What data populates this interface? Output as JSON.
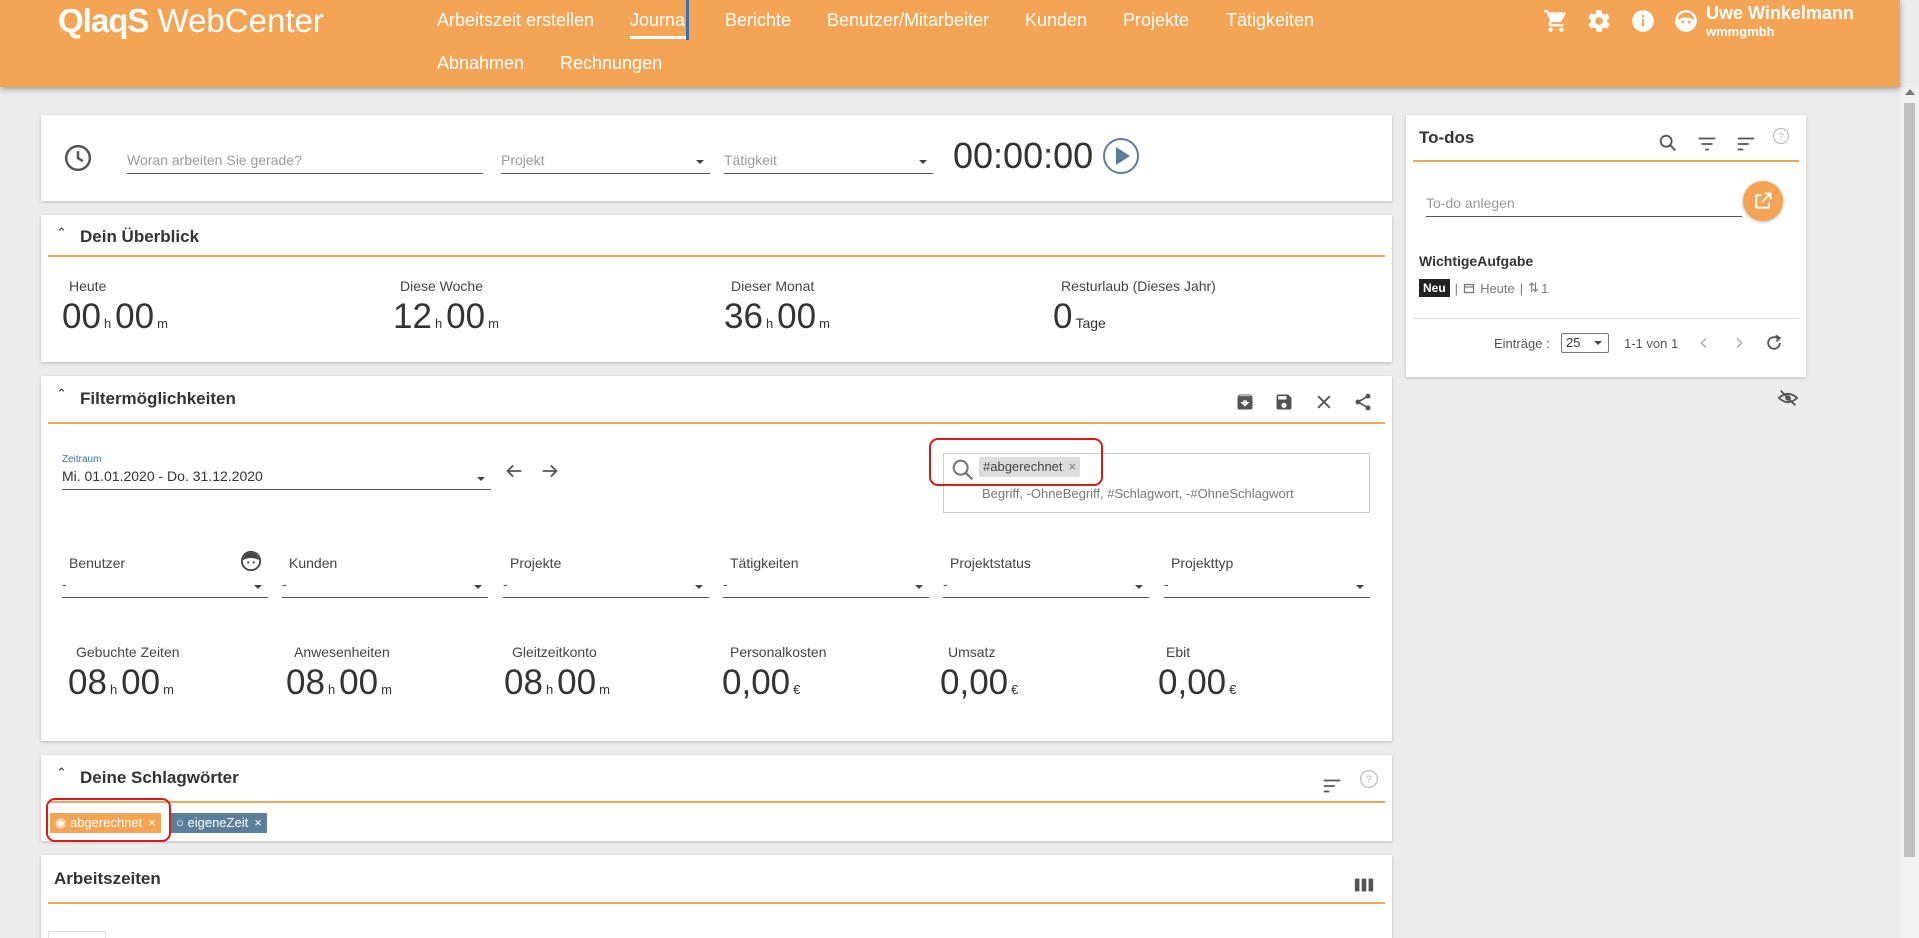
{
  "header": {
    "logo_bold": "QlaqS",
    "logo_rest": "WebCenter",
    "nav": [
      {
        "label": "Arbeitszeit erstellen"
      },
      {
        "label": "Journal"
      },
      {
        "label": "Berichte"
      },
      {
        "label": "Benutzer/Mitarbeiter"
      },
      {
        "label": "Kunden"
      },
      {
        "label": "Projekte"
      },
      {
        "label": "Tätigkeiten"
      },
      {
        "label": "Abnahmen"
      },
      {
        "label": "Rechnungen"
      }
    ],
    "active_nav": "Journal",
    "user_name": "Uwe Winkelmann",
    "user_org": "wmmgmbh"
  },
  "timer": {
    "task_placeholder": "Woran arbeiten Sie gerade?",
    "project_placeholder": "Projekt",
    "activity_placeholder": "Tätigkeit",
    "time": "00:00:00"
  },
  "overview": {
    "title": "Dein Überblick",
    "stats": [
      {
        "label": "Heute",
        "h": "00",
        "m": "00"
      },
      {
        "label": "Diese Woche",
        "h": "12",
        "m": "00"
      },
      {
        "label": "Dieser Monat",
        "h": "36",
        "m": "00"
      }
    ],
    "vacation": {
      "label": "Resturlaub (Dieses Jahr)",
      "value": "0",
      "unit": "Tage"
    },
    "unit_h": "h",
    "unit_m": "m"
  },
  "filters": {
    "title": "Filtermöglichkeiten",
    "period_label": "Zeitraum",
    "period_value": "Mi. 01.01.2020 - Do. 31.12.2020",
    "search_chip": "#abgerechnet",
    "search_hint": "Begriff, -OhneBegriff, #Schlagwort, -#OhneSchlagwort",
    "dropdowns": [
      {
        "label": "Benutzer",
        "value": "-"
      },
      {
        "label": "Kunden",
        "value": "-"
      },
      {
        "label": "Projekte",
        "value": "-"
      },
      {
        "label": "Tätigkeiten",
        "value": "-"
      },
      {
        "label": "Projektstatus",
        "value": "-"
      },
      {
        "label": "Projekttyp",
        "value": "-"
      }
    ],
    "totals": [
      {
        "label": "Gebuchte Zeiten",
        "a": "08",
        "u1": "h",
        "b": "00",
        "u2": "m"
      },
      {
        "label": "Anwesenheiten",
        "a": "08",
        "u1": "h",
        "b": "00",
        "u2": "m"
      },
      {
        "label": "Gleitzeitkonto",
        "a": "08",
        "u1": "h",
        "b": "00",
        "u2": "m"
      },
      {
        "label": "Personalkosten",
        "a": "0,00",
        "u1": "€"
      },
      {
        "label": "Umsatz",
        "a": "0,00",
        "u1": "€"
      },
      {
        "label": "Ebit",
        "a": "0,00",
        "u1": "€"
      }
    ]
  },
  "tags": {
    "title": "Deine Schlagwörter",
    "items": [
      {
        "label": "abgerechnet",
        "color": "#f3a455"
      },
      {
        "label": "eigeneZeit",
        "color": "#5b7f9a"
      }
    ],
    "close": "×"
  },
  "worktimes": {
    "title": "Arbeitszeiten"
  },
  "todos": {
    "title": "To-dos",
    "create_placeholder": "To-do anlegen",
    "items": [
      {
        "title": "WichtigeAufgabe",
        "badge": "Neu",
        "due": "Heute",
        "count": "1"
      }
    ],
    "entries_label": "Einträge :",
    "entries_value": "25",
    "entries_options": [
      "25"
    ],
    "range": "1-1 von 1"
  },
  "colors": {
    "accent": "#f3a455",
    "accent_dark": "#e58b2f",
    "tag_blue": "#5b7f9a",
    "highlight": "#d91a1a"
  }
}
